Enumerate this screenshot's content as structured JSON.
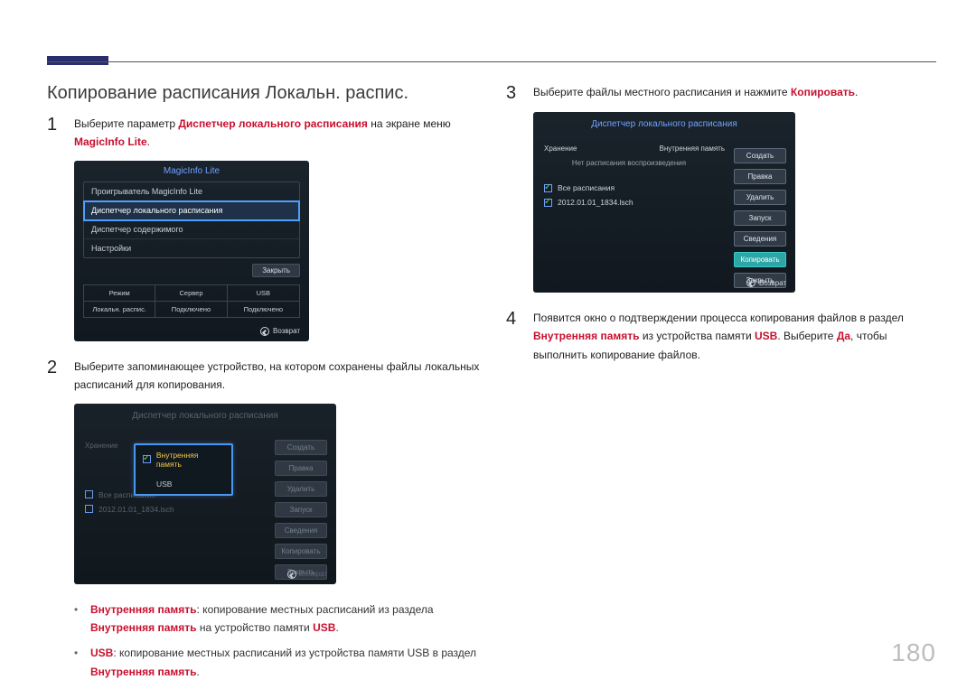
{
  "page_number": "180",
  "section_title": "Копирование расписания Локальн. распис.",
  "steps": {
    "s1": {
      "pre": "Выберите параметр ",
      "em1": "Диспетчер локального расписания",
      "mid": " на экране меню ",
      "em2": "MagicInfo Lite",
      "post": "."
    },
    "s2": "Выберите запоминающее устройство, на котором сохранены файлы локальных расписаний для копирования.",
    "b1": {
      "em1": "Внутренняя память",
      "t1": ": копирование местных расписаний из раздела ",
      "em2": "Внутренняя память",
      "t2": " на устройство памяти ",
      "em3": "USB",
      "t3": "."
    },
    "b2": {
      "em1": "USB",
      "t1": ": копирование местных расписаний из устройства памяти USB в раздел ",
      "em2": "Внутренняя память",
      "t2": "."
    },
    "s3": {
      "pre": "Выберите файлы местного расписания и нажмите ",
      "em": "Копировать",
      "post": "."
    },
    "s4": {
      "pre": "Появится окно о подтверждении процесса копирования файлов в раздел ",
      "em1": "Внутренняя память",
      "mid": " из устройства памяти ",
      "em2": "USB",
      "mid2": ". Выберите ",
      "em3": "Да",
      "post": ", чтобы выполнить копирование файлов."
    }
  },
  "shot1": {
    "title": "MagicInfo Lite",
    "items": [
      "Проигрыватель MagicInfo Lite",
      "Диспетчер локального расписания",
      "Диспетчер содержимого",
      "Настройки"
    ],
    "close": "Закрыть",
    "grid": [
      "Режим",
      "Сервер",
      "USB",
      "Локальн. распис.",
      "Подключено",
      "Подключено"
    ],
    "ret": "Возврат"
  },
  "shot2": {
    "title": "Диспетчер локального расписания",
    "head_store": "Хранение",
    "popup": {
      "internal": "Внутренняя память",
      "usb": "USB"
    },
    "side": [
      "Создать",
      "Правка",
      "Удалить",
      "Запуск",
      "Сведения",
      "Копировать",
      "Закрыть"
    ],
    "all": "Все расписания",
    "file": "2012.01.01_1834.lsch",
    "ret": "Возврат"
  },
  "shot3": {
    "title": "Диспетчер локального расписания",
    "head_store": "Хранение",
    "head_mem": "Внутренняя память",
    "noplay": "Нет расписания воспроизведения",
    "all": "Все расписания",
    "file": "2012.01.01_1834.lsch",
    "side": [
      "Создать",
      "Правка",
      "Удалить",
      "Запуск",
      "Сведения",
      "Копировать",
      "Закрыть"
    ],
    "ret": "Возврат"
  }
}
